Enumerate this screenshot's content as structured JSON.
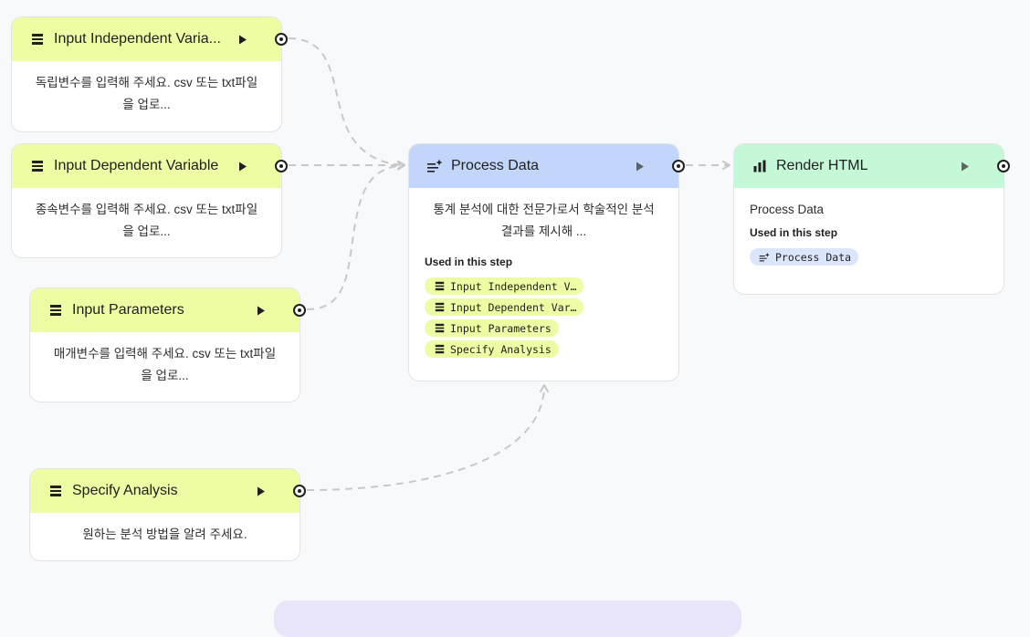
{
  "nodes": {
    "input_independent": {
      "title": "Input Independent Varia...",
      "description": "독립변수를 입력해 주세요. csv 또는 txt파일을 업로..."
    },
    "input_dependent": {
      "title": "Input Dependent Variable",
      "description": "종속변수를 입력해 주세요. csv 또는 txt파일을 업로..."
    },
    "input_parameters": {
      "title": "Input Parameters",
      "description": "매개변수를 입력해 주세요. csv 또는 txt파일을 업로..."
    },
    "specify_analysis": {
      "title": "Specify Analysis",
      "description": "원하는 분석 방법을 알려 주세요."
    },
    "process_data": {
      "title": "Process Data",
      "description": "통계 분석에 대한 전문가로서 학술적인 분석 결과를 제시해 ...",
      "used_title": "Used in this step",
      "chips": [
        "Input Independent V…",
        "Input Dependent Var…",
        "Input Parameters",
        "Specify Analysis"
      ]
    },
    "render_html": {
      "title": "Render HTML",
      "description": "Process Data",
      "used_title": "Used in this step",
      "chips": [
        "Process Data"
      ]
    }
  },
  "colors": {
    "input_header": "#eefca4",
    "process_header": "#c2d5fb",
    "render_header": "#c5f8d7",
    "edge": "#c8c8c8"
  },
  "icons": {
    "input": "input-lines-icon",
    "process": "sparkle-list-icon",
    "render": "bar-chart-icon",
    "run": "play-icon",
    "port": "output-port-icon"
  }
}
